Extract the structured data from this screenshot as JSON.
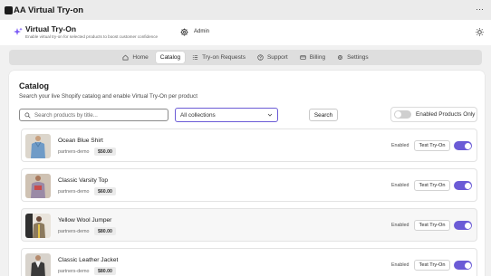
{
  "window": {
    "app_initials": "AA",
    "title": "AA Virtual Try-on",
    "more_icon": "more-dots-icon"
  },
  "header": {
    "brand_name": "Virtual Try-On",
    "tagline": "Enable virtual try-on for selected products to boost customer confidence",
    "admin_label": "Admin",
    "accent": "#7c5cf6"
  },
  "nav": {
    "tabs": [
      {
        "label": "Home",
        "icon": "home-icon",
        "active": false
      },
      {
        "label": "Catalog",
        "icon": "",
        "active": true
      },
      {
        "label": "Try-on Requests",
        "icon": "list-icon",
        "active": false
      },
      {
        "label": "Support",
        "icon": "help-icon",
        "active": false
      },
      {
        "label": "Billing",
        "icon": "card-icon",
        "active": false
      },
      {
        "label": "Settings",
        "icon": "gear-icon",
        "active": false
      }
    ]
  },
  "catalog": {
    "title": "Catalog",
    "subtitle": "Search your live Shopify catalog and enable Virtual Try-On per product",
    "search_placeholder": "Search products by title...",
    "collection_value": "All collections",
    "search_button": "Search",
    "filter_label": "Enabled Products Only",
    "filter_on": false,
    "toggle_color": "#6b5bd6"
  },
  "products": [
    {
      "name": "Ocean Blue Shirt",
      "vendor": "partners-demo",
      "price": "$50.00",
      "status": "Enabled",
      "action": "Test Try-On",
      "enabled": true
    },
    {
      "name": "Classic Varsity Top",
      "vendor": "partners-demo",
      "price": "$60.00",
      "status": "Enabled",
      "action": "Test Try-On",
      "enabled": true
    },
    {
      "name": "Yellow Wool Jumper",
      "vendor": "partners-demo",
      "price": "$80.00",
      "status": "Enabled",
      "action": "Test Try-On",
      "enabled": true
    },
    {
      "name": "Classic Leather Jacket",
      "vendor": "partners-demo",
      "price": "$80.00",
      "status": "Enabled",
      "action": "Test Try-On",
      "enabled": true
    }
  ]
}
